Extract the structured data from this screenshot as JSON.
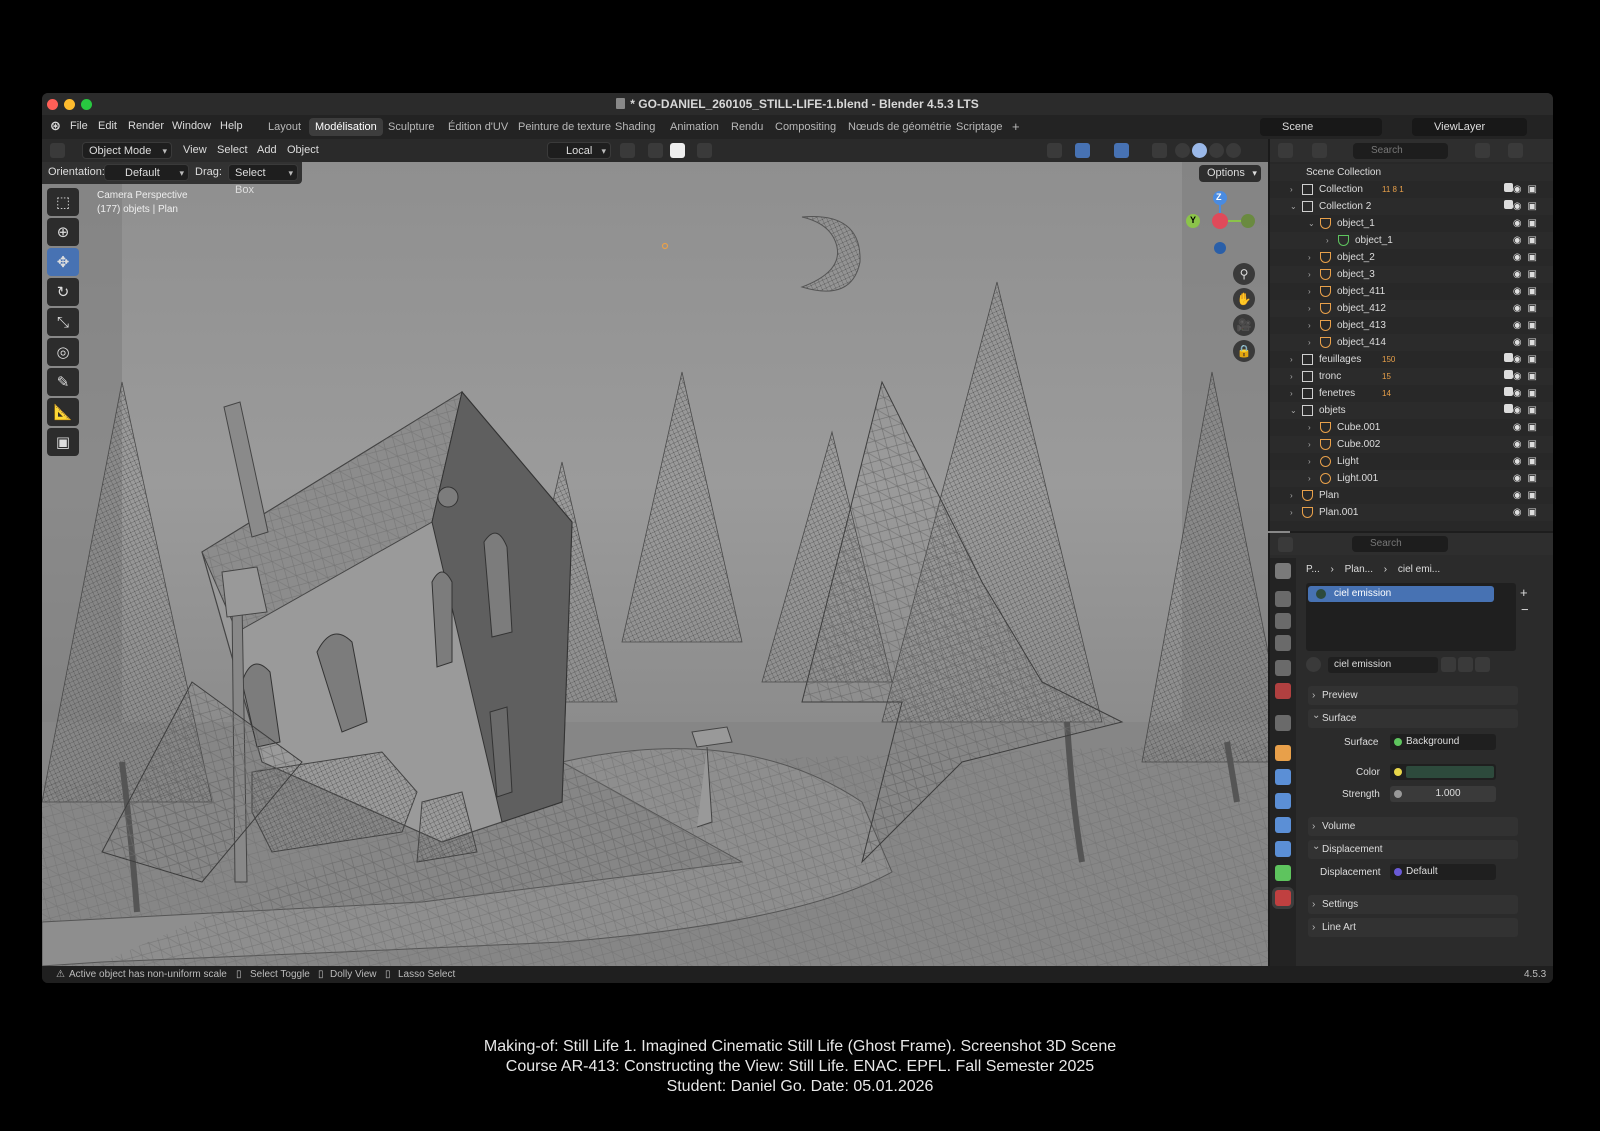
{
  "window": {
    "title": "* GO-DANIEL_260105_STILL-LIFE-1.blend - Blender 4.5.3 LTS"
  },
  "menubar": {
    "items": [
      "File",
      "Edit",
      "Render",
      "Window",
      "Help"
    ],
    "workspaces": [
      "Layout",
      "Modélisation",
      "Sculpture",
      "Édition d'UV",
      "Peinture de texture",
      "Shading",
      "Animation",
      "Rendu",
      "Compositing",
      "Nœuds de géométrie",
      "Scriptage"
    ],
    "active_workspace": "Modélisation",
    "add_tab": "+",
    "scene": "Scene",
    "view_layer": "ViewLayer"
  },
  "viewport_header": {
    "mode": "Object Mode",
    "menus": [
      "View",
      "Select",
      "Add",
      "Object"
    ],
    "transform_orientation": "Local",
    "orientation_label": "Orientation:",
    "orientation_value": "Default",
    "drag_label": "Drag:",
    "drag_value": "Select Box",
    "options": "Options"
  },
  "viewport": {
    "camera_label": "Camera Perspective",
    "object_info": "(177) objets | Plan",
    "gizmo_axes": [
      "Z",
      "Y",
      "X"
    ]
  },
  "statusbar": {
    "warning": "Active object has non-uniform scale",
    "hint1": "Select Toggle",
    "hint2": "Dolly View",
    "hint3": "Lasso Select",
    "version": "4.5.3"
  },
  "outliner": {
    "search_placeholder": "Search",
    "root": "Scene Collection",
    "rows": [
      {
        "label": "Collection",
        "depth": 1,
        "type": "collection",
        "extra": "11 8 1",
        "checked": true
      },
      {
        "label": "Collection 2",
        "depth": 1,
        "type": "collection",
        "extra": "",
        "checked": true
      },
      {
        "label": "object_1",
        "depth": 2,
        "type": "mesh",
        "extra": "",
        "checked": false
      },
      {
        "label": "object_1",
        "depth": 3,
        "type": "meshdata",
        "extra": "",
        "checked": false
      },
      {
        "label": "object_2",
        "depth": 2,
        "type": "mesh",
        "extra": "",
        "checked": false
      },
      {
        "label": "object_3",
        "depth": 2,
        "type": "mesh",
        "extra": "",
        "checked": false
      },
      {
        "label": "object_411",
        "depth": 2,
        "type": "mesh",
        "extra": "",
        "checked": false
      },
      {
        "label": "object_412",
        "depth": 2,
        "type": "mesh",
        "extra": "",
        "checked": false
      },
      {
        "label": "object_413",
        "depth": 2,
        "type": "mesh",
        "extra": "",
        "checked": false
      },
      {
        "label": "object_414",
        "depth": 2,
        "type": "mesh",
        "extra": "",
        "checked": false
      },
      {
        "label": "feuillages",
        "depth": 1,
        "type": "collection",
        "extra": "150",
        "checked": true
      },
      {
        "label": "tronc",
        "depth": 1,
        "type": "collection",
        "extra": "15",
        "checked": true
      },
      {
        "label": "fenetres",
        "depth": 1,
        "type": "collection",
        "extra": "14",
        "checked": true
      },
      {
        "label": "objets",
        "depth": 1,
        "type": "collection",
        "extra": "",
        "checked": true
      },
      {
        "label": "Cube.001",
        "depth": 2,
        "type": "mesh",
        "extra": "",
        "checked": false
      },
      {
        "label": "Cube.002",
        "depth": 2,
        "type": "mesh",
        "extra": "",
        "checked": false
      },
      {
        "label": "Light",
        "depth": 2,
        "type": "light",
        "extra": "",
        "checked": false
      },
      {
        "label": "Light.001",
        "depth": 2,
        "type": "light",
        "extra": "",
        "checked": false
      },
      {
        "label": "Plan",
        "depth": 1,
        "type": "mesh",
        "extra": "",
        "checked": false
      },
      {
        "label": "Plan.001",
        "depth": 1,
        "type": "mesh",
        "extra": "",
        "checked": false
      }
    ]
  },
  "properties": {
    "search_placeholder": "Search",
    "breadcrumb": [
      "P...",
      "Plan...",
      "ciel emi..."
    ],
    "material_slot": "ciel emission",
    "material_name": "ciel emission",
    "panels": {
      "preview": "Preview",
      "surface": "Surface",
      "volume": "Volume",
      "displacement": "Displacement",
      "settings": "Settings",
      "line_art": "Line Art"
    },
    "surface_label": "Surface",
    "surface_value": "Background",
    "color_label": "Color",
    "color_value": "#2d4a3c",
    "strength_label": "Strength",
    "strength_value": "1.000",
    "displacement_label": "Displacement",
    "displacement_value": "Default"
  },
  "caption": {
    "line1": "Making-of: Still Life 1. Imagined Cinematic Still Life (Ghost Frame). Screenshot 3D Scene",
    "line2": "Course AR-413: Constructing the View: Still Life. ENAC. EPFL. Fall Semester 2025",
    "line3": "Student: Daniel Go. Date: 05.01.2026"
  },
  "colors": {
    "accent": "#4772b3",
    "mesh_icon": "#e8a04a",
    "data_icon": "#5ec45e",
    "axis_x": "#e04a5a",
    "axis_y": "#8bc34a",
    "axis_z": "#4a8be0"
  }
}
